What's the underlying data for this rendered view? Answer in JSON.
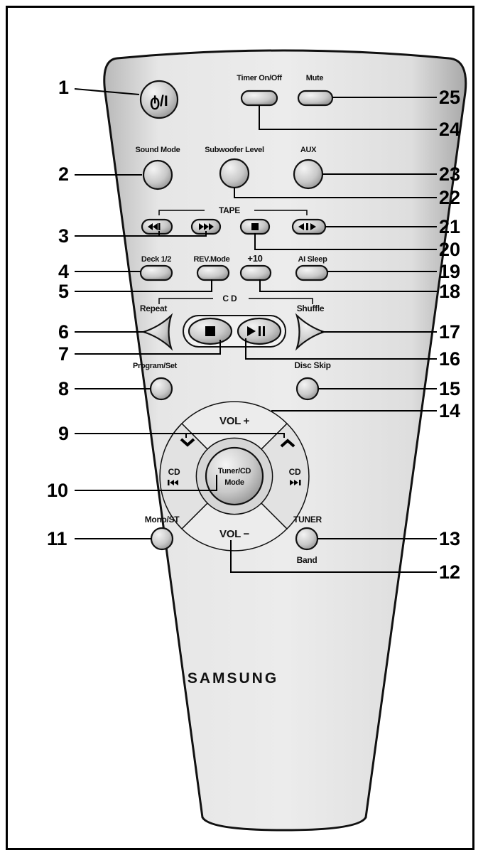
{
  "remote": {
    "brand": "SAMSUNG",
    "power_label": "ტ/I",
    "labels": {
      "timer": "Timer On/Off",
      "mute": "Mute",
      "sound_mode": "Sound Mode",
      "subwoofer": "Subwoofer Level",
      "aux": "AUX",
      "tape": "TAPE",
      "deck": "Deck 1/2",
      "rev_mode": "REV.Mode",
      "plus10": "+10",
      "ai_sleep": "AI Sleep",
      "cd": "CD",
      "repeat": "Repeat",
      "shuffle": "Shuffle",
      "program_set": "Program/Set",
      "disc_skip": "Disc Skip",
      "vol_plus": "VOL +",
      "vol_minus": "VOL −",
      "tuner_cd_mode_1": "Tuner/CD",
      "tuner_cd_mode_2": "Mode",
      "cd_left": "CD",
      "cd_right": "CD",
      "mono_st": "Mono/ST",
      "tuner": "TUNER",
      "band": "Band"
    }
  },
  "callouts": {
    "n1": "1",
    "n2": "2",
    "n3": "3",
    "n4": "4",
    "n5": "5",
    "n6": "6",
    "n7": "7",
    "n8": "8",
    "n9": "9",
    "n10": "10",
    "n11": "11",
    "n12": "12",
    "n13": "13",
    "n14": "14",
    "n15": "15",
    "n16": "16",
    "n17": "17",
    "n18": "18",
    "n19": "19",
    "n20": "20",
    "n21": "21",
    "n22": "22",
    "n23": "23",
    "n24": "24",
    "n25": "25"
  }
}
